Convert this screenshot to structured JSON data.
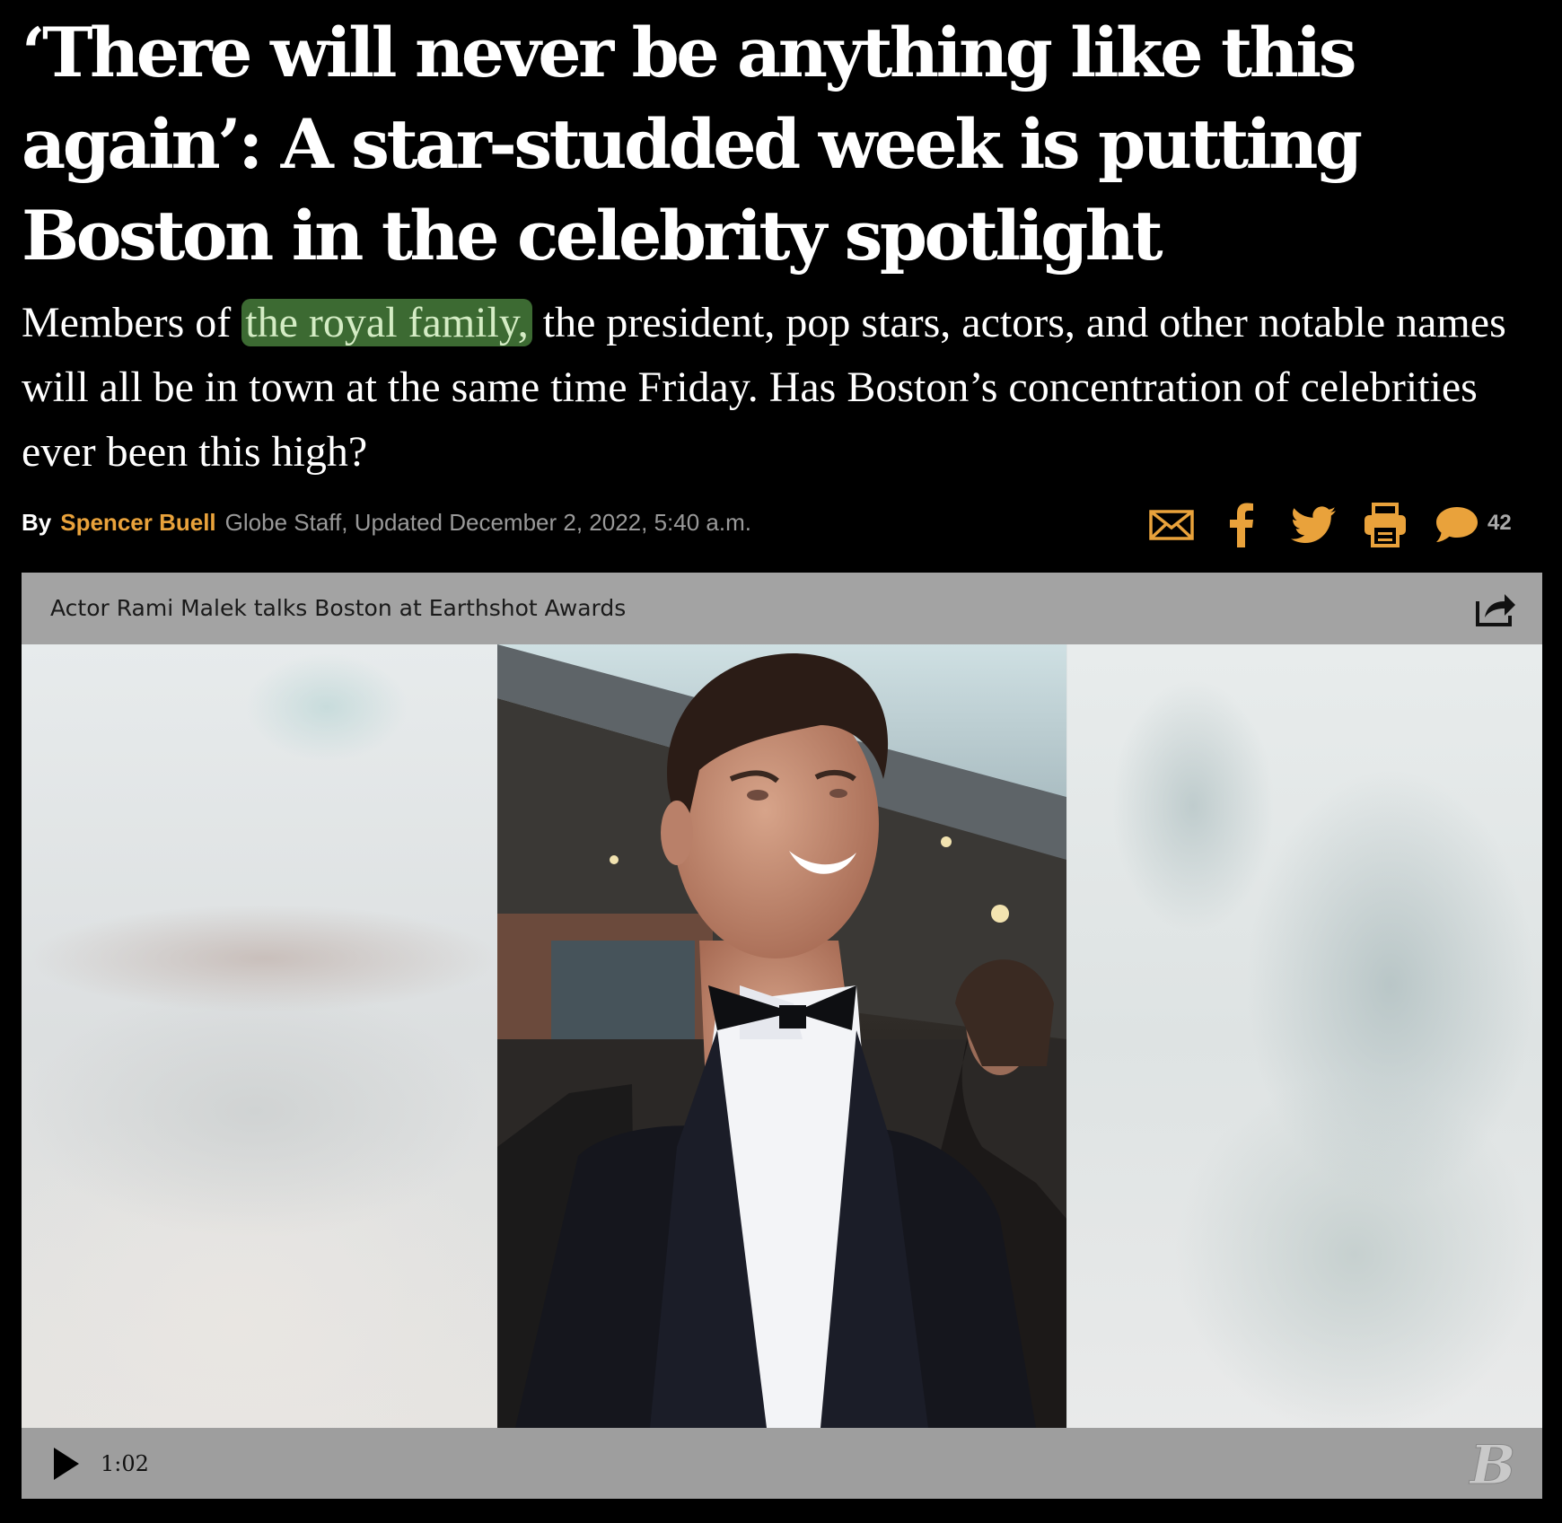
{
  "article": {
    "headline": "‘There will never be anything like this again’: A star-studded week is putting Boston in the celebrity spotlight",
    "dek": {
      "before": "Members of ",
      "highlight": "the royal family,",
      "after": " the president, pop stars, actors, and other notable names will all be in town at the same time Friday. Has Boston’s concentration of celebrities ever been this high?"
    },
    "byline": {
      "by_label": "By",
      "author": "Spencer Buell",
      "meta": "Globe Staff, Updated December 2, 2022, 5:40 a.m."
    }
  },
  "share_tools": {
    "icons": [
      "email-icon",
      "facebook-icon",
      "twitter-icon",
      "print-icon",
      "comment-icon"
    ],
    "comment_count": "42",
    "accent_color": "#e9a23b"
  },
  "video": {
    "title": "Actor Rami Malek talks Boston at Earthshot Awards",
    "duration": "1:02",
    "share_icon": "share-arrow-icon",
    "play_icon": "play-icon",
    "logo": "boston-globe-b-logo"
  },
  "colors": {
    "background": "#000000",
    "highlight_bg": "#3c6a32",
    "byline_meta": "#999999",
    "player_bar": "#a3a3a3"
  }
}
